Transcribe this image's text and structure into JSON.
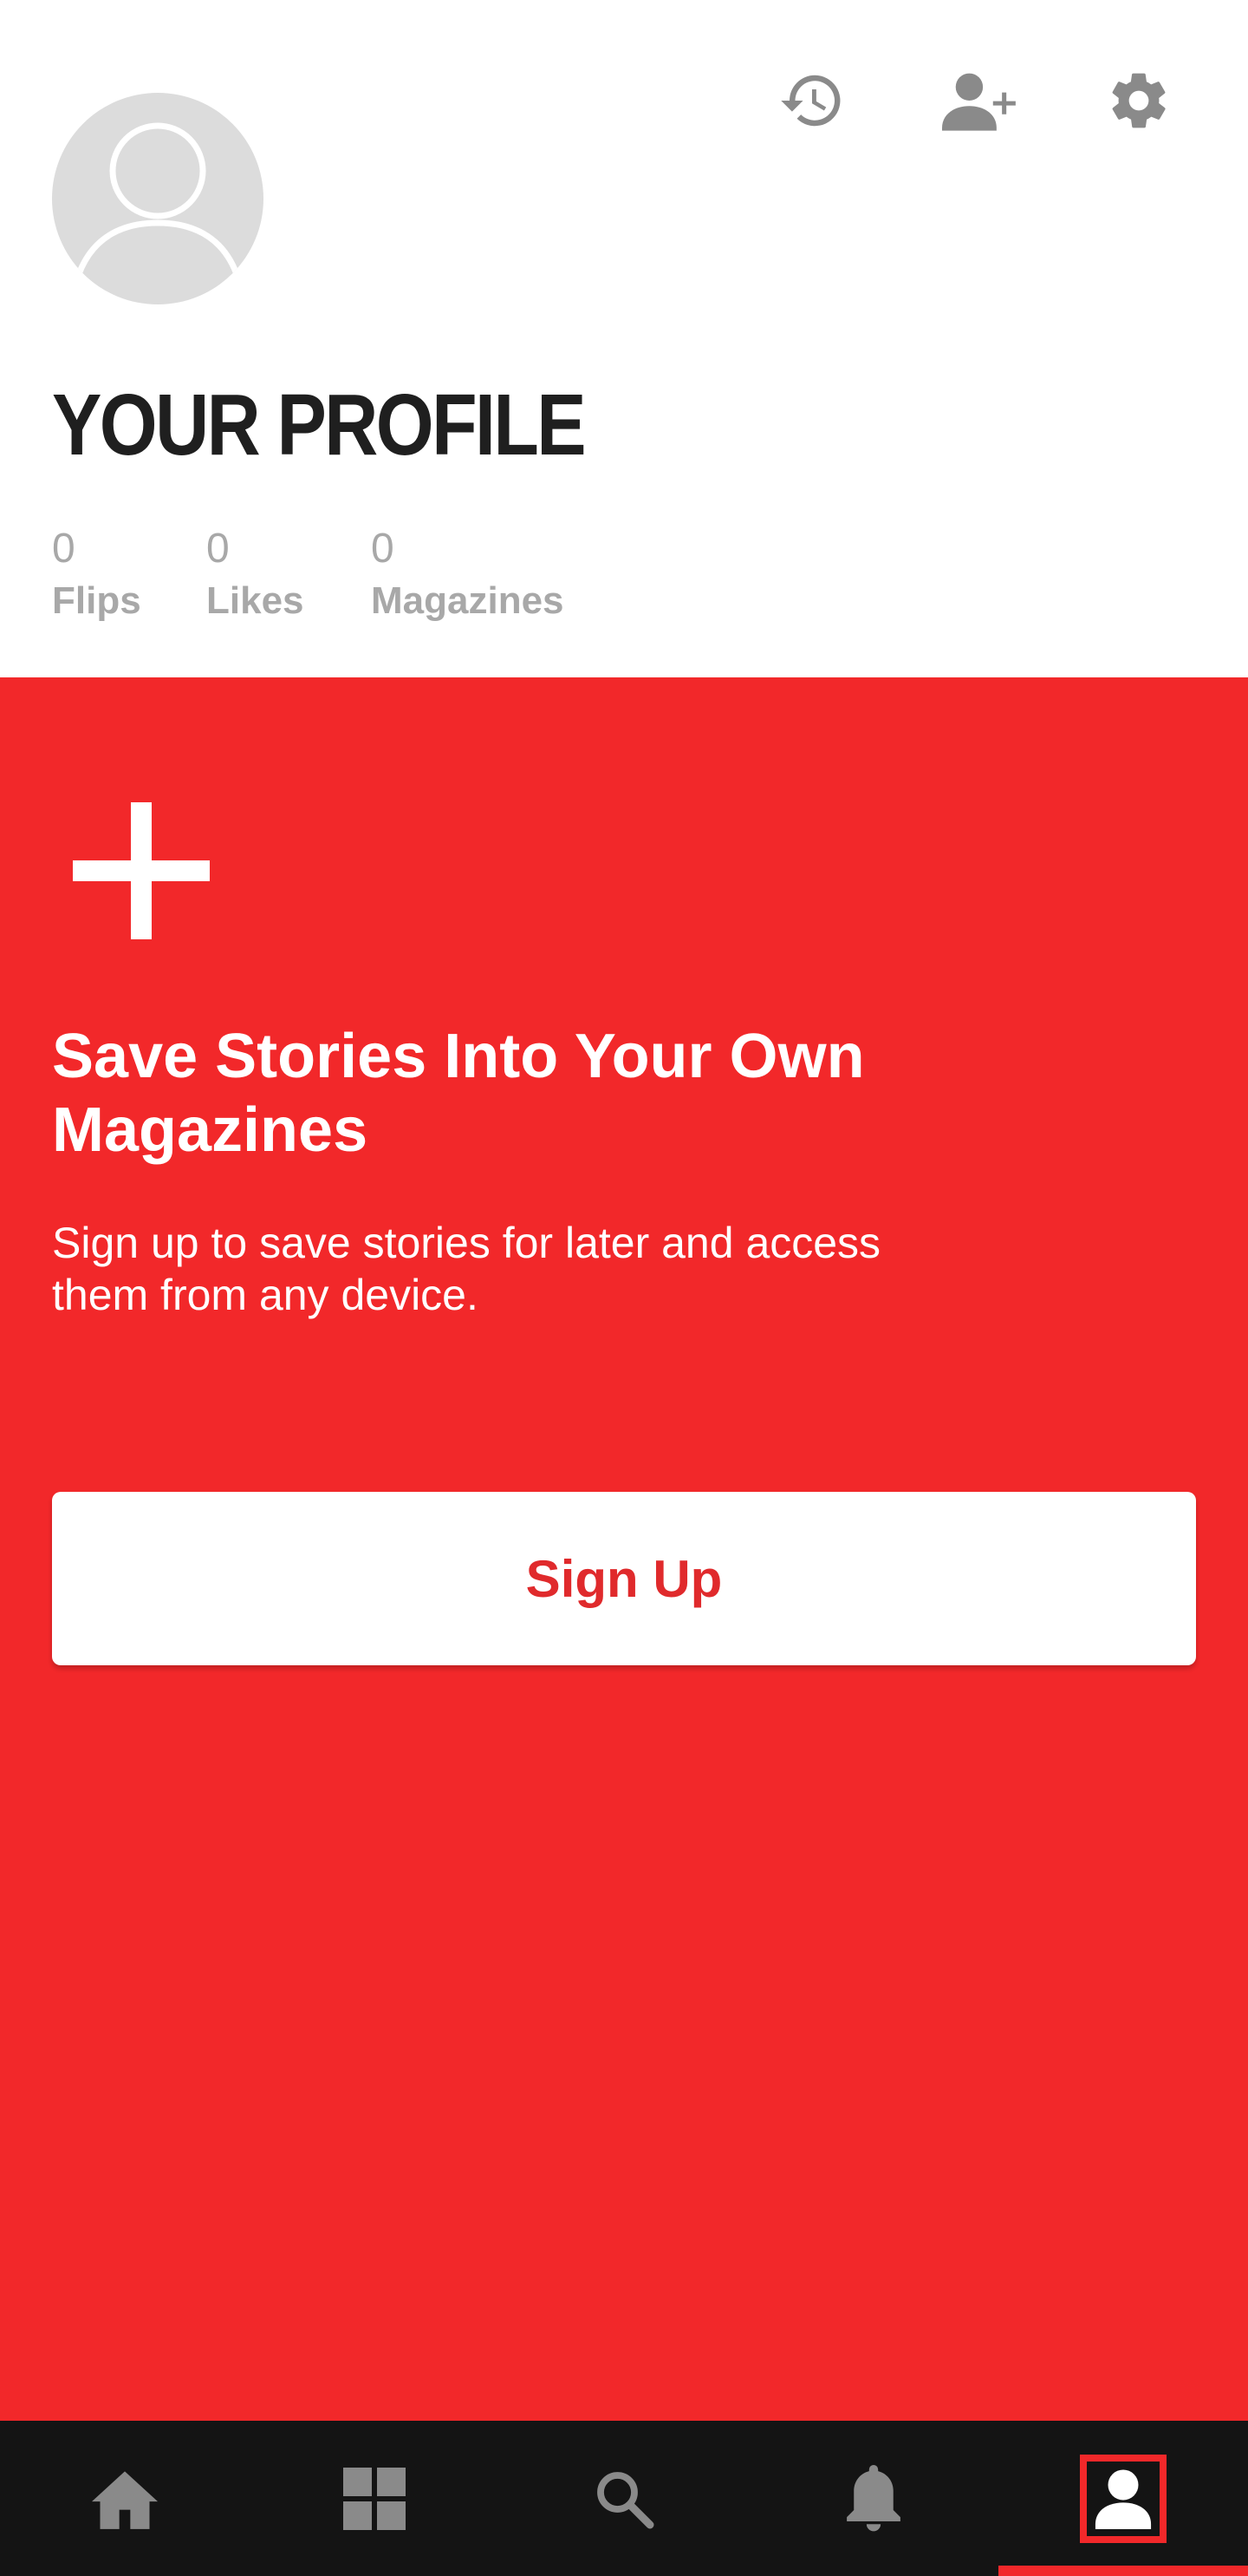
{
  "header": {
    "title": "YOUR PROFILE",
    "avatar_icon": "default-avatar-icon",
    "actions": [
      {
        "name": "history",
        "icon": "history-icon"
      },
      {
        "name": "add-friend",
        "icon": "add-person-icon"
      },
      {
        "name": "settings",
        "icon": "gear-icon"
      }
    ],
    "stats": {
      "flips": {
        "value": "0",
        "label": "Flips"
      },
      "likes": {
        "value": "0",
        "label": "Likes"
      },
      "magazines": {
        "value": "0",
        "label": "Magazines"
      }
    }
  },
  "promo": {
    "icon": "plus-icon",
    "title": "Save Stories Into Your Own Magazines",
    "text": "Sign up to save stories for later and access them from any device.",
    "button_label": "Sign Up"
  },
  "bottom_nav": {
    "items": [
      {
        "name": "home",
        "icon": "home-icon"
      },
      {
        "name": "explore",
        "icon": "grid-icon"
      },
      {
        "name": "search",
        "icon": "search-icon"
      },
      {
        "name": "notifications",
        "icon": "bell-icon"
      },
      {
        "name": "profile",
        "icon": "person-icon",
        "selected": true
      }
    ]
  },
  "colors": {
    "accent_red": "#f2282a",
    "nav_background": "#141414",
    "icon_gray": "#8a8a8a",
    "avatar_gray": "#dcdcdc"
  }
}
